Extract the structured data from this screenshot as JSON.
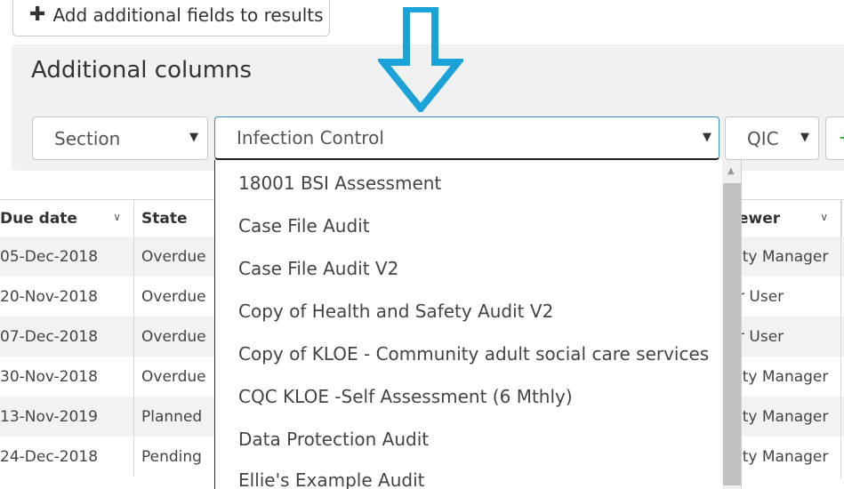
{
  "toolbar": {
    "add_fields_label": "Add additional fields to results",
    "add_icon": "plus-icon"
  },
  "panel": {
    "title": "Additional columns"
  },
  "selects": {
    "section": {
      "value": "Section"
    },
    "survey": {
      "value": "Infection Control"
    },
    "qic": {
      "value": "QIC"
    }
  },
  "colors": {
    "arrow": "#19a3d8",
    "focus_border": "#3b8fd6",
    "add_green": "#3aa63a"
  },
  "table": {
    "headers": {
      "due_date": "Due date",
      "state": "State",
      "reviewer": "ewer"
    },
    "rows": [
      {
        "due": "05-Dec-2018",
        "state": "Overdue",
        "reviewer": "ity Manager"
      },
      {
        "due": "20-Nov-2018",
        "state": "Overdue",
        "reviewer": "r User"
      },
      {
        "due": "07-Dec-2018",
        "state": "Overdue",
        "reviewer": "r User"
      },
      {
        "due": "30-Nov-2018",
        "state": "Overdue",
        "reviewer": "ity Manager"
      },
      {
        "due": "13-Nov-2019",
        "state": "Planned",
        "reviewer": "ity Manager"
      },
      {
        "due": "24-Dec-2018",
        "state": "Pending",
        "reviewer": "ity Manager"
      }
    ]
  },
  "dropdown": {
    "options": [
      "18001 BSI Assessment",
      "Case File Audit",
      "Case File Audit V2",
      "Copy of Health and Safety Audit V2",
      "Copy of KLOE - Community adult social care services",
      "CQC KLOE -Self Assessment (6 Mthly)",
      "Data Protection Audit",
      "Ellie's Example Audit"
    ]
  }
}
